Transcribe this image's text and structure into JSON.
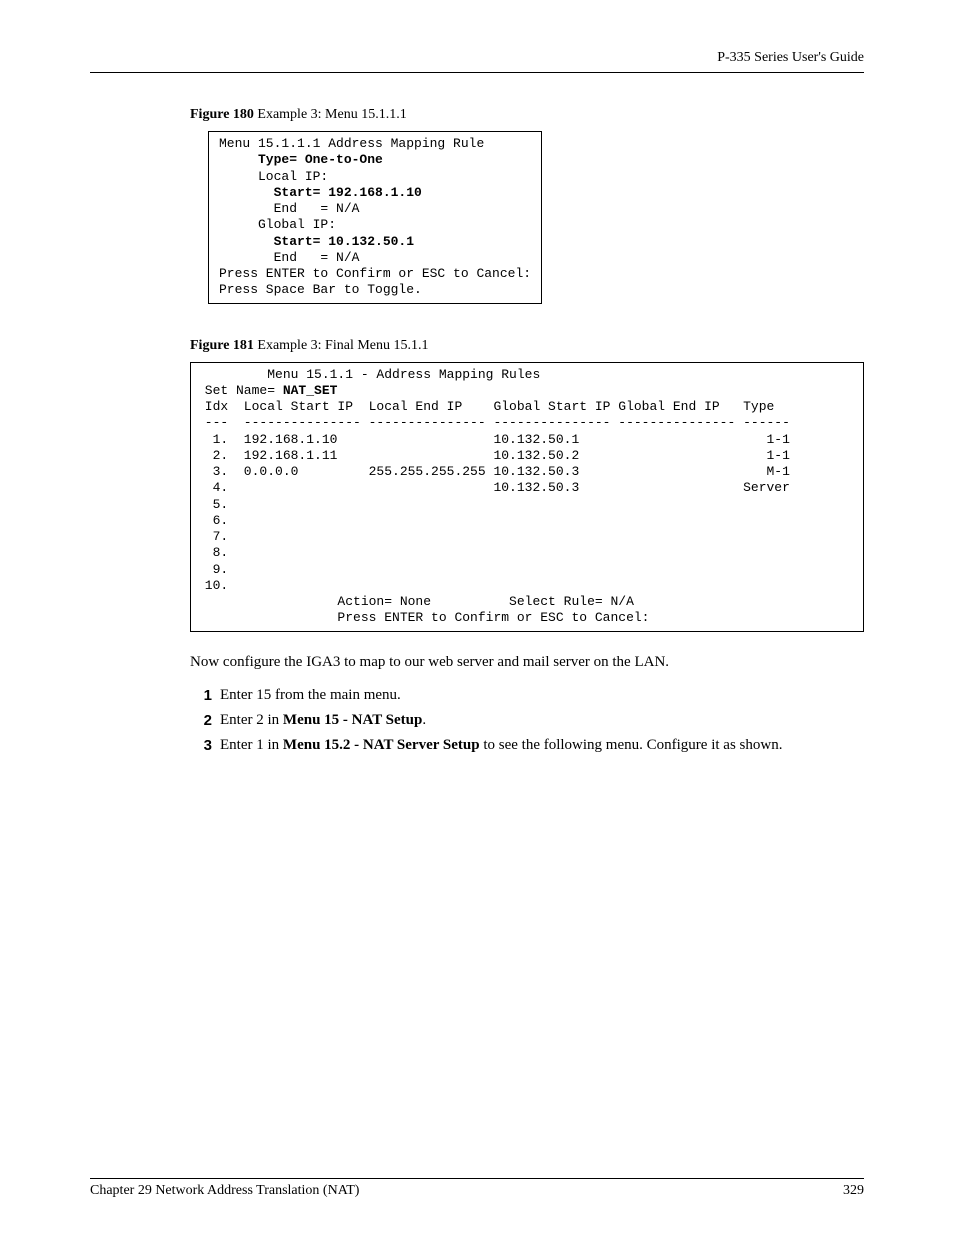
{
  "header": {
    "guide": "P-335 Series User's Guide"
  },
  "fig180": {
    "label_bold": "Figure 180",
    "label_rest": "   Example 3: Menu 15.1.1.1",
    "l1": "Menu 15.1.1.1 Address Mapping Rule",
    "l2": "     Type= One-to-One",
    "l3": "     Local IP:",
    "l4": "       Start= 192.168.1.10",
    "l5": "       End   = N/A",
    "l6": "     Global IP:",
    "l7": "       Start= 10.132.50.1",
    "l8": "       End   = N/A",
    "l9": "Press ENTER to Confirm or ESC to Cancel:",
    "l10": "Press Space Bar to Toggle."
  },
  "fig181": {
    "label_bold": "Figure 181",
    "label_rest": "   Example 3: Final Menu 15.1.1",
    "title": "         Menu 15.1.1 - Address Mapping Rules",
    "setname_lbl": " Set Name= ",
    "setname_val": "NAT_SET",
    "hdr": " Idx  Local Start IP  Local End IP    Global Start IP Global End IP   Type",
    "rule": " ---  --------------- --------------- --------------- --------------- ------",
    "r1": "  1.  192.168.1.10                    10.132.50.1                        1-1",
    "r2": "  2.  192.168.1.11                    10.132.50.2                        1-1",
    "r3": "  3.  0.0.0.0         255.255.255.255 10.132.50.3                        M-1",
    "r4": "  4.                                  10.132.50.3                     Server",
    "r5": "  5.",
    "r6": "  6.",
    "r7": "  7.",
    "r8": "  8.",
    "r9": "  9.",
    "r10": " 10.",
    "action": "                  Action= None          Select Rule= N/A",
    "press": "                  Press ENTER to Confirm or ESC to Cancel:"
  },
  "body": {
    "para": "Now configure the IGA3 to map to our web server and mail server on the LAN.",
    "s1": "Enter 15 from the main menu.",
    "s2a": "Enter 2 in ",
    "s2b": "Menu 15 - NAT Setup",
    "s2c": ".",
    "s3a": "Enter 1 in ",
    "s3b": "Menu 15.2 - NAT Server Setup",
    "s3c": " to see the following menu. Configure it as shown."
  },
  "footer": {
    "chapter": "Chapter 29 Network Address Translation (NAT)",
    "page": "329"
  }
}
